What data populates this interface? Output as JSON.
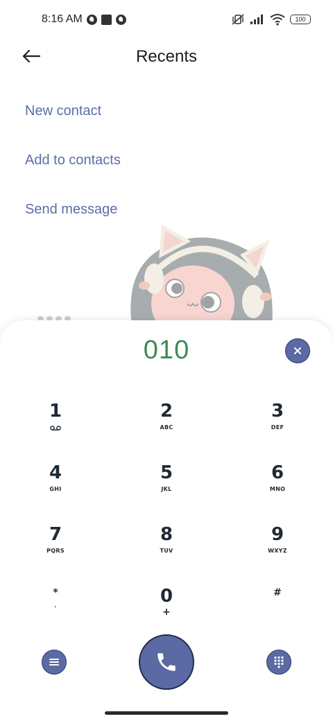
{
  "status_bar": {
    "time": "8:16 AM",
    "battery": "100",
    "icons": [
      "data-saver-icon",
      "stop-icon",
      "data-saver-icon",
      "vibrate-off-icon",
      "signal-icon",
      "wifi-icon",
      "battery-icon"
    ]
  },
  "header": {
    "title": "Recents",
    "back_icon": "arrow-left-icon"
  },
  "actions": [
    {
      "label": "New contact"
    },
    {
      "label": "Add to contacts"
    },
    {
      "label": "Send message"
    }
  ],
  "dialer": {
    "number": "010",
    "clear_icon": "close-icon",
    "keys": [
      {
        "digit": "1",
        "letters": ""
      },
      {
        "digit": "2",
        "letters": "ABC"
      },
      {
        "digit": "3",
        "letters": "DEF"
      },
      {
        "digit": "4",
        "letters": "GHI"
      },
      {
        "digit": "5",
        "letters": "JKL"
      },
      {
        "digit": "6",
        "letters": "MNO"
      },
      {
        "digit": "7",
        "letters": "PQRS"
      },
      {
        "digit": "8",
        "letters": "TUV"
      },
      {
        "digit": "9",
        "letters": "WXYZ"
      },
      {
        "digit": "*",
        "letters": "."
      },
      {
        "digit": "0",
        "letters": "+"
      },
      {
        "digit": "#",
        "letters": ""
      }
    ],
    "menu_icon": "menu-icon",
    "call_icon": "phone-icon",
    "keypad_icon": "dialpad-icon"
  },
  "colors": {
    "accent": "#5b6aa3",
    "link": "#5a6ea6",
    "number": "#3d8a55",
    "key_text": "#1f2a33"
  }
}
